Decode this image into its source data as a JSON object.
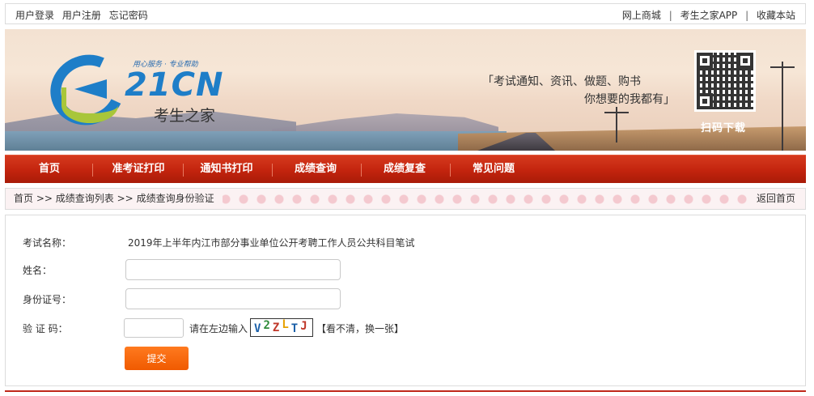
{
  "topbar": {
    "login": "用户登录",
    "register": "用户注册",
    "forgot": "忘记密码",
    "mall": "网上商城",
    "app": "考生之家APP",
    "favorite": "收藏本站",
    "separator": "|"
  },
  "banner": {
    "slogan": "用心服务 · 专业帮助",
    "brand": "21CN",
    "site_name": "考生之家",
    "tagline_line1": "「考试通知、资讯、做题、购书",
    "tagline_line2": "你想要的我都有」",
    "qr_label": "扫码下载"
  },
  "nav": {
    "items": [
      "首页",
      "准考证打印",
      "通知书打印",
      "成绩查询",
      "成绩复查",
      "常见问题"
    ]
  },
  "breadcrumb": {
    "home": "首页",
    "sep": ">>",
    "list": "成绩查询列表",
    "current": "成绩查询身份验证",
    "back": "返回首页"
  },
  "form": {
    "exam_label": "考试名称：",
    "exam_name": "2019年上半年内江市部分事业单位公开考聘工作人员公共科目笔试",
    "name_label": "姓名：",
    "name_value": "",
    "id_label": "身份证号：",
    "id_value": "",
    "captcha_label": "验 证 码：",
    "captcha_value": "",
    "captcha_hint": "请在左边输入",
    "captcha_chars": [
      {
        "ch": "V",
        "color": "#1a5fa8"
      },
      {
        "ch": "2",
        "color": "#2e8b3a"
      },
      {
        "ch": "Z",
        "color": "#c0392b"
      },
      {
        "ch": "L",
        "color": "#e6a100"
      },
      {
        "ch": "T",
        "color": "#1a5fa8"
      },
      {
        "ch": "J",
        "color": "#c0392b"
      }
    ],
    "refresh_text": "【看不清，换一张】",
    "submit_label": "提交"
  },
  "colors": {
    "nav_red": "#c3240e",
    "submit_orange": "#f05a00",
    "brand_blue": "#1e7ec8"
  }
}
